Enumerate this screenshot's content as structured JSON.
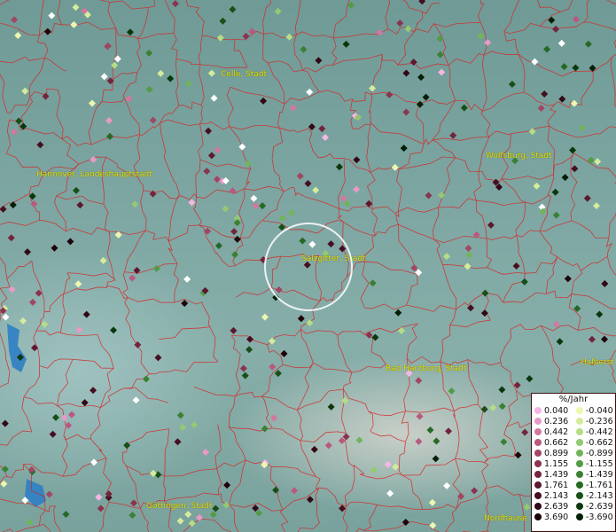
{
  "cities": [
    {
      "id": "celle",
      "label": "Celle, Stadt"
    },
    {
      "id": "wolfsburg",
      "label": "Wolfsburg, Stadt"
    },
    {
      "id": "hannover",
      "label": "Hannover, Landeshauptstadt"
    },
    {
      "id": "salzgitter",
      "label": "Salzgitter, Stadt"
    },
    {
      "id": "bad-harzburg",
      "label": "Bad Harzburg, Stadt"
    },
    {
      "id": "halberstadt",
      "label": "Halberst"
    },
    {
      "id": "goettingen",
      "label": "Göttingen, Stadt"
    },
    {
      "id": "nordhausen",
      "label": "Nordhause"
    }
  ],
  "legend": {
    "title": "%/Jahr",
    "positive": [
      {
        "label": "0.040",
        "color": "#f6b6e4"
      },
      {
        "label": "0.236",
        "color": "#e79ac6"
      },
      {
        "label": "0.442",
        "color": "#d0789f"
      },
      {
        "label": "0.662",
        "color": "#b85a7f"
      },
      {
        "label": "0.899",
        "color": "#a04764"
      },
      {
        "label": "1.155",
        "color": "#8a3550"
      },
      {
        "label": "1.439",
        "color": "#73253e"
      },
      {
        "label": "1.761",
        "color": "#5d1830"
      },
      {
        "label": "2.143",
        "color": "#470e22"
      },
      {
        "label": "2.639",
        "color": "#320716"
      },
      {
        "label": "3.690",
        "color": "#1e020a"
      }
    ],
    "negative": [
      {
        "label": "-0.040",
        "color": "#eef7b0"
      },
      {
        "label": "-0.236",
        "color": "#d3ec9c"
      },
      {
        "label": "-0.442",
        "color": "#b5dd86"
      },
      {
        "label": "-0.662",
        "color": "#92c972"
      },
      {
        "label": "-0.899",
        "color": "#70b45c"
      },
      {
        "label": "-1.155",
        "color": "#529c47"
      },
      {
        "label": "-1.439",
        "color": "#3a8134"
      },
      {
        "label": "-1.761",
        "color": "#266824"
      },
      {
        "label": "-2.143",
        "color": "#174f17"
      },
      {
        "label": "-2.639",
        "color": "#0b370d"
      },
      {
        "label": "-3.690",
        "color": "#031f06"
      }
    ]
  },
  "colors": {
    "border_lines": "#d42828",
    "city_label": "#e6e000",
    "highlight_ring": "#ffffff",
    "water": "#2f7fc4"
  }
}
